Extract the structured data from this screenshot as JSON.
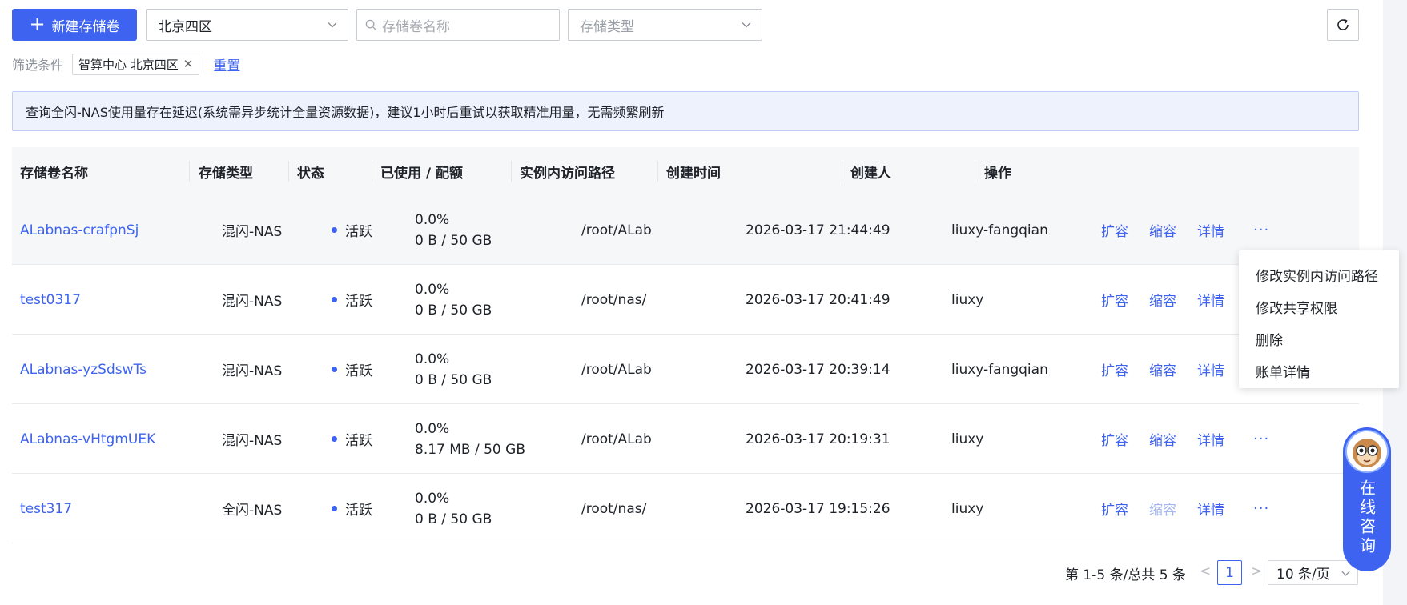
{
  "toolbar": {
    "create_button": "新建存储卷",
    "region_select": "北京四区",
    "search_placeholder": "存储卷名称",
    "type_select_placeholder": "存储类型"
  },
  "filters": {
    "label": "筛选条件",
    "tag": "智算中心 北京四区",
    "reset": "重置"
  },
  "notice": "查询全闪-NAS使用量存在延迟(系统需异步统计全量资源数据)，建议1小时后重试以获取精准用量，无需频繁刷新",
  "table": {
    "columns": [
      "存储卷名称",
      "存储类型",
      "状态",
      "已使用 / 配额",
      "实例内访问路径",
      "创建时间",
      "创建人",
      "操作"
    ],
    "rows": [
      {
        "name": "ALabnas-crafpnSj",
        "type": "混闪-NAS",
        "status": "活跃",
        "usage_pct": "0.0%",
        "usage": "0 B / 50 GB",
        "path": "/root/ALab",
        "created": "2026-03-17 21:44:49",
        "creator": "liuxy-fangqian"
      },
      {
        "name": "test0317",
        "type": "混闪-NAS",
        "status": "活跃",
        "usage_pct": "0.0%",
        "usage": "0 B / 50 GB",
        "path": "/root/nas/",
        "created": "2026-03-17 20:41:49",
        "creator": "liuxy"
      },
      {
        "name": "ALabnas-yzSdswTs",
        "type": "混闪-NAS",
        "status": "活跃",
        "usage_pct": "0.0%",
        "usage": "0 B / 50 GB",
        "path": "/root/ALab",
        "created": "2026-03-17 20:39:14",
        "creator": "liuxy-fangqian"
      },
      {
        "name": "ALabnas-vHtgmUEK",
        "type": "混闪-NAS",
        "status": "活跃",
        "usage_pct": "0.0%",
        "usage": "8.17 MB / 50 GB",
        "path": "/root/ALab",
        "created": "2026-03-17 20:19:31",
        "creator": "liuxy"
      },
      {
        "name": "test317",
        "type": "全闪-NAS",
        "status": "活跃",
        "usage_pct": "0.0%",
        "usage": "0 B / 50 GB",
        "path": "/root/nas/",
        "created": "2026-03-17 19:15:26",
        "creator": "liuxy"
      }
    ],
    "actions": {
      "expand": "扩容",
      "shrink": "缩容",
      "detail": "详情",
      "more": "···"
    }
  },
  "dropdown": {
    "items": [
      "修改实例内访问路径",
      "修改共享权限",
      "删除",
      "账单详情"
    ]
  },
  "pagination": {
    "total": "第 1-5 条/总共 5 条",
    "prev": "<",
    "current_page": "1",
    "next": ">",
    "page_size": "10 条/页"
  },
  "consult": {
    "label": "在线咨询"
  },
  "colors": {
    "accent": "#3d63f0",
    "notice_bg": "#eef2fd",
    "header_bg": "#f6f7f9"
  }
}
